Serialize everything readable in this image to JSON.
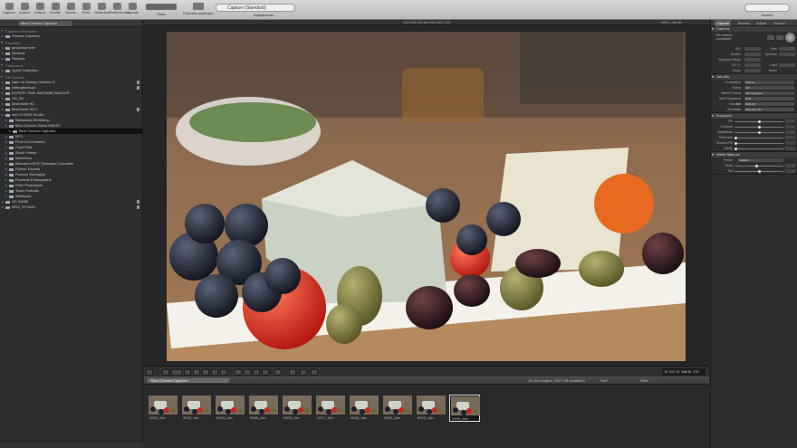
{
  "toolbar": {
    "left_buttons": [
      "Capture",
      "Export",
      "Output",
      "Modify",
      "Delete",
      "Print",
      "Slideshow",
      "Preferences",
      "Layouts"
    ],
    "show_label": "Show",
    "portrait_landscape_label": "Portrait/Landscape",
    "title_field": "Capture (Standard)",
    "adjustments_label": "Adjustments",
    "search_label": "Search"
  },
  "library": {
    "search_value": "Blue Cheese Captures",
    "sections": [
      {
        "title": "Capture Destination",
        "items": [
          {
            "label": "Phocus Captures",
            "indent": 1,
            "locked": false
          }
        ]
      },
      {
        "title": "Favorites",
        "items": [
          {
            "label": "geoyoholmeier",
            "indent": 1,
            "locked": false
          },
          {
            "label": "Desktop",
            "indent": 1,
            "locked": false
          },
          {
            "label": "Pictures",
            "indent": 1,
            "locked": false
          }
        ]
      },
      {
        "title": "Collections",
        "items": [
          {
            "label": "Quick Collection",
            "indent": 1,
            "locked": false
          }
        ]
      },
      {
        "title": "File System",
        "items": [
          {
            "label": "Nam ue Sweety Chicken 3",
            "indent": 1,
            "locked": true
          },
          {
            "label": "editingbackup1",
            "indent": 1,
            "locked": true
          },
          {
            "label": "EXPERT TIME MACHINE BACKUP",
            "indent": 1,
            "locked": false
          },
          {
            "label": "HD_3D",
            "indent": 1,
            "locked": false
          },
          {
            "label": "Macintosh HD",
            "indent": 1,
            "locked": false
          },
          {
            "label": "Macintosh HD 2",
            "indent": 1,
            "locked": true
          },
          {
            "label": "mini G-RAID Studio",
            "indent": 1,
            "locked": false
          },
          {
            "label": "Balsamiao Workshop",
            "indent": 2,
            "locked": false
          },
          {
            "label": "Blue Cheese Olives HASSY",
            "indent": 2,
            "locked": false
          },
          {
            "label": "Blue Cheese Captures",
            "indent": 3,
            "locked": false,
            "selected": true
          },
          {
            "label": "BTS",
            "indent": 2,
            "locked": false
          },
          {
            "label": "Final Cut Libraries",
            "indent": 2,
            "locked": false
          },
          {
            "label": "Food Files",
            "indent": 2,
            "locked": false
          },
          {
            "label": "Stock Videos",
            "indent": 2,
            "locked": false
          },
          {
            "label": "Interviews",
            "indent": 2,
            "locked": false
          },
          {
            "label": "Michael w BTS Timelapse Complete",
            "indent": 2,
            "locked": false
          },
          {
            "label": "Python Exports",
            "indent": 2,
            "locked": false
          },
          {
            "label": "Product Timelapse",
            "indent": 2,
            "locked": false
          },
          {
            "label": "Products Photography",
            "indent": 2,
            "locked": false
          },
          {
            "label": "RGD Photobooth",
            "indent": 2,
            "locked": false
          },
          {
            "label": "Team Portraits",
            "indent": 2,
            "locked": false
          },
          {
            "label": "Widescan",
            "indent": 2,
            "locked": false
          },
          {
            "label": "VG SAME",
            "indent": 1,
            "locked": true
          },
          {
            "label": "RDG_STUDIO",
            "indent": 1,
            "locked": true
          }
        ]
      }
    ]
  },
  "viewer": {
    "info_text": "ISO 100   1/8 sec   f/8.0   HC 100",
    "file_name": "0009_Job.3fr"
  },
  "viewer_bar": {
    "rgb_readout": "R: 227  G: 186  B: 172"
  },
  "filmstrip": {
    "folder_pill": "Blue Cheese Captures",
    "count_text": "10 (4/1 images, 1837 GB available)",
    "sort_label": "Sort",
    "filter_label": "Filter",
    "thumbs": [
      {
        "label": "0002_Job"
      },
      {
        "label": "0003_Job"
      },
      {
        "label": "0004_Job"
      },
      {
        "label": "0005_Job"
      },
      {
        "label": "0006_Job"
      },
      {
        "label": "0007_Job"
      },
      {
        "label": "0008_Job"
      },
      {
        "label": "0009_Job"
      },
      {
        "label": "0010_Job"
      },
      {
        "label": "0009_Job",
        "selected": true
      }
    ]
  },
  "right_panel": {
    "tabs": [
      "Capture",
      "Browse",
      "Adjust",
      "Export"
    ],
    "camera": {
      "title": "Camera",
      "status": "No camera connected",
      "rows": [
        {
          "l": "ISO",
          "v": "",
          "l2": "Type",
          "v2": ""
        },
        {
          "l": "Shutter",
          "v": "",
          "l2": "Aperture",
          "v2": ""
        },
        {
          "l": "Exposure Mode",
          "v": "",
          "l2": "",
          "v2": ""
        },
        {
          "l": "EV +/-",
          "v": "",
          "l2": "Light Meter",
          "v2": ""
        },
        {
          "l": "Focus",
          "v": "",
          "l2": "",
          "v2": ""
        }
      ]
    },
    "job_info": {
      "title": "Job Info",
      "rows": [
        {
          "l": "Destination",
          "v": "Phocus"
        },
        {
          "l": "Name",
          "v": "Job"
        },
        {
          "l": "Name Format",
          "v": "Job Sequence"
        },
        {
          "l": "Next Sequence Number",
          "v": "0011"
        },
        {
          "l": "Job",
          "v": "2016-08"
        },
        {
          "l": "Metadata",
          "v": "Standard Info"
        }
      ]
    },
    "exposure": {
      "title": "Exposure",
      "sliders": [
        {
          "label": "EV",
          "level": 0.5
        },
        {
          "label": "Contrast",
          "level": 0.5
        },
        {
          "label": "Brightness",
          "level": 0.5
        },
        {
          "label": "Recovery",
          "level": 0.02
        },
        {
          "label": "Shadow Fill",
          "level": 0.02
        },
        {
          "label": "Clarity",
          "level": 0.02
        }
      ]
    },
    "white_balance": {
      "title": "White Balance",
      "preset_label": "Preset",
      "preset_value": "Daylight",
      "sliders": [
        {
          "label": "Temp",
          "level": 0.45
        },
        {
          "label": "Tint",
          "level": 0.5
        }
      ]
    }
  },
  "colors": {
    "accent": "#3b76c6",
    "selection": "#111111"
  }
}
